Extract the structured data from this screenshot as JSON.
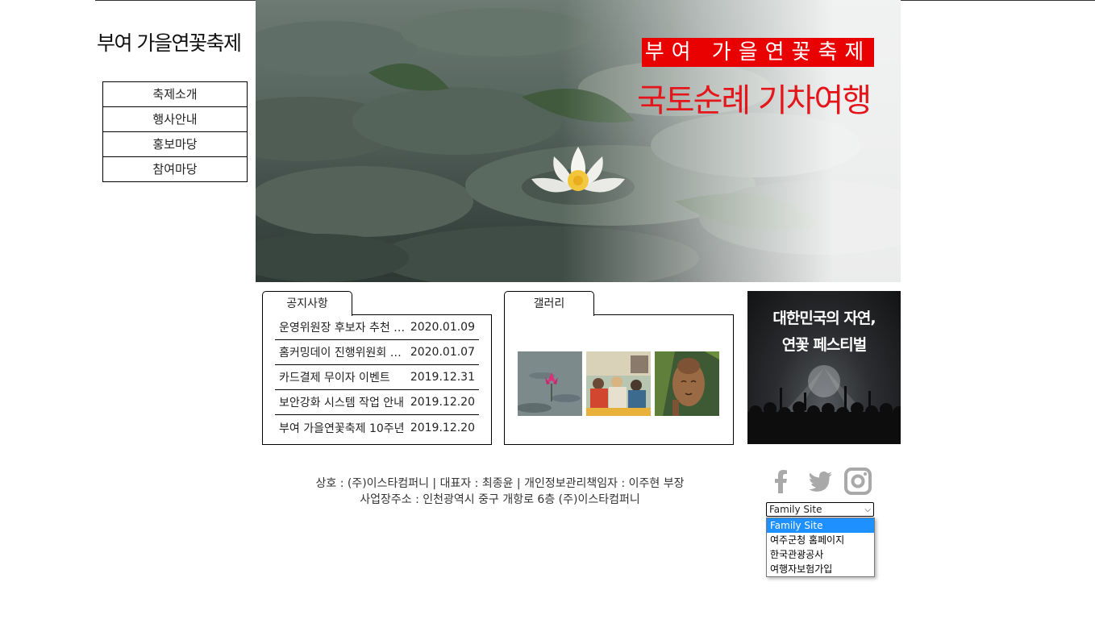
{
  "site": {
    "logo": "부여 가을연꽃축제"
  },
  "menu": {
    "items": [
      {
        "label": "축제소개"
      },
      {
        "label": "행사안내"
      },
      {
        "label": "홍보마당"
      },
      {
        "label": "참여마당"
      }
    ]
  },
  "hero": {
    "badge": "부여 가을연꽃축제",
    "title": "국토순례 기차여행"
  },
  "notice": {
    "tab_label": "공지사항",
    "rows": [
      {
        "title": "운영위원장 후보자 추천 안내",
        "date": "2020.01.09"
      },
      {
        "title": "홈커밍데이 진행위원회 모집",
        "date": "2020.01.07"
      },
      {
        "title": "카드결제 무이자 이벤트",
        "date": "2019.12.31"
      },
      {
        "title": "보안강화 시스템 작업 안내",
        "date": "2019.12.20"
      },
      {
        "title": "부여 가을연꽃축제 10주년",
        "date": "2019.12.20"
      }
    ]
  },
  "gallery": {
    "tab_label": "갤러리"
  },
  "banner": {
    "line1": "대한민국의 자연,",
    "line2": "연꽃 페스티벌"
  },
  "footer": {
    "line1": "상호 : (주)이스타컴퍼니 | 대표자 : 최종윤 | 개인정보관리책임자 : 이주현 부장",
    "line2": "사업장주소 : 인천광역시 중구 개항로 6층 (주)이스타컴퍼니"
  },
  "social": {
    "icons": [
      "facebook-icon",
      "twitter-icon",
      "instagram-icon"
    ]
  },
  "family_site": {
    "selected": "Family Site",
    "options": [
      "Family Site",
      "여주군청 홈페이지",
      "한국관광공사",
      "여행자보험가입"
    ],
    "highlight_color": "#1e90ff"
  },
  "colors": {
    "accent_red": "#e90000",
    "title_red": "#e4161b"
  }
}
